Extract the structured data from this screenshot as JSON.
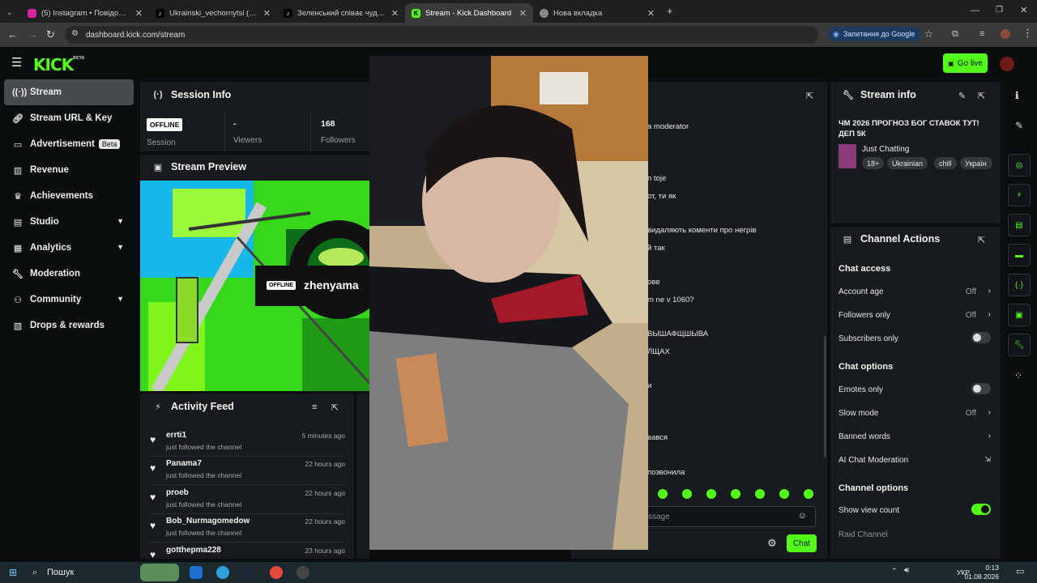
{
  "browser": {
    "tabs": [
      {
        "title": "(5) Instagram • Повідомлення",
        "icon": "instagram-icon"
      },
      {
        "title": "Ukrainski_vechornytsi (@ukrain",
        "icon": "tiktok-icon"
      },
      {
        "title": "Зеленський співає чудову пісн",
        "icon": "tiktok-icon"
      },
      {
        "title": "Stream - Kick Dashboard",
        "icon": "kick-icon"
      },
      {
        "title": "Нова вкладка",
        "icon": "globe-icon"
      }
    ],
    "url": "dashboard.kick.com/stream",
    "google_pill": "Запитання до Google"
  },
  "header": {
    "logo": "KICK",
    "logo_badge": "BETA",
    "go_live": "Go live"
  },
  "sidebar": {
    "items": [
      {
        "label": "Stream",
        "icon": "broadcast-icon"
      },
      {
        "label": "Stream URL & Key",
        "icon": "link-icon"
      },
      {
        "label": "Advertisement",
        "icon": "ad-icon",
        "badge": "Beta"
      },
      {
        "label": "Revenue",
        "icon": "revenue-icon"
      },
      {
        "label": "Achievements",
        "icon": "trophy-icon"
      },
      {
        "label": "Studio",
        "icon": "studio-icon"
      },
      {
        "label": "Analytics",
        "icon": "analytics-icon"
      },
      {
        "label": "Moderation",
        "icon": "wrench-icon"
      },
      {
        "label": "Community",
        "icon": "community-icon"
      },
      {
        "label": "Drops & rewards",
        "icon": "drops-icon"
      }
    ]
  },
  "session": {
    "title": "Session Info",
    "status": "OFFLINE",
    "status_label": "Session",
    "viewers_value": "-",
    "viewers_label": "Viewers",
    "followers_value": "168",
    "followers_label": "Followers"
  },
  "preview": {
    "title": "Stream Preview",
    "offline_badge": "OFFLINE",
    "channel_name": "zhenyama"
  },
  "activity": {
    "title": "Activity Feed",
    "items": [
      {
        "name": "errti1",
        "desc": "just followed the channel",
        "time": "5 minutes ago"
      },
      {
        "name": "Panama7",
        "desc": "just followed the channel",
        "time": "22 hours ago"
      },
      {
        "name": "proeb",
        "desc": "just followed the channel",
        "time": "22 hours ago"
      },
      {
        "name": "Bob_Nurmagomedow",
        "desc": "just followed the channel",
        "time": "22 hours ago"
      },
      {
        "name": "gotthepma228",
        "desc": "",
        "time": "23 hours ago"
      }
    ]
  },
  "chat": {
    "lines": [
      "a moderator",
      "n toje",
      "от, ти як",
      "видаляють коменти про негрів",
      "й так",
      "ове",
      "m ne v 1060?",
      "ВЫШАФЩШЫВА",
      "ЛЩАХ",
      "и",
      "вався",
      "позвонила"
    ],
    "input_placeholder": "ssage",
    "send_label": "Chat"
  },
  "stream_info": {
    "title": "Stream info",
    "stream_title": "ЧМ 2026 ПРОГНОЗ БОГ СТАВОК ТУТ! ДЕП 5К",
    "category": "Just Chatting",
    "tags": [
      "18+",
      "Ukrainian",
      "chill",
      "Україн"
    ]
  },
  "channel_actions": {
    "title": "Channel Actions",
    "chat_access_heading": "Chat access",
    "account_age": {
      "label": "Account age",
      "value": "Off"
    },
    "followers_only": {
      "label": "Followers only",
      "value": "Off"
    },
    "subscribers_only": {
      "label": "Subscribers only",
      "enabled": false
    },
    "chat_options_heading": "Chat options",
    "emotes_only": {
      "label": "Emotes only",
      "enabled": false
    },
    "slow_mode": {
      "label": "Slow mode",
      "value": "Off"
    },
    "banned_words": {
      "label": "Banned words"
    },
    "ai_moderation": {
      "label": "AI Chat Moderation"
    },
    "channel_options_heading": "Channel options",
    "show_view_count": {
      "label": "Show view count",
      "enabled": true
    },
    "raid_channel": {
      "label": "Raid Channel"
    }
  },
  "taskbar": {
    "search": "Пошук",
    "lang": "УКР",
    "time": "0:13",
    "date": "01.08.2026"
  },
  "colors": {
    "accent": "#53fc18",
    "panel": "#181b1d",
    "background": "#0b0e0f"
  }
}
